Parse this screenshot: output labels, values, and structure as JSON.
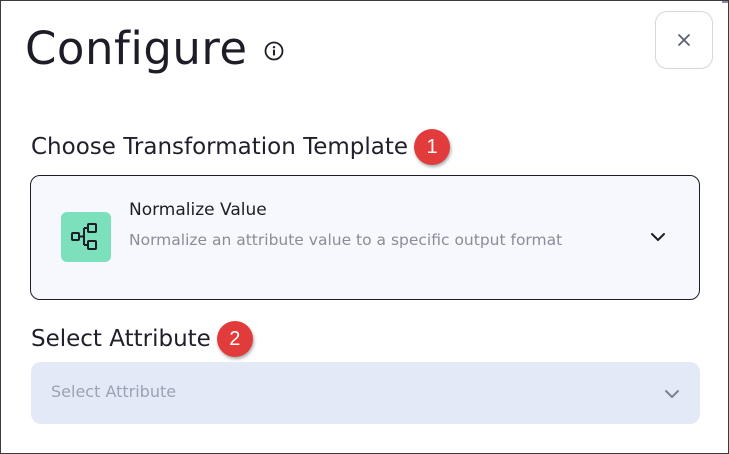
{
  "dialog": {
    "title": "Configure",
    "close_label": "×"
  },
  "sections": {
    "template": {
      "label": "Choose Transformation Template",
      "step": "1",
      "selected": {
        "name": "Normalize Value",
        "description": "Normalize an attribute value to a specific output format",
        "icon": "flow-tree-icon"
      }
    },
    "attribute": {
      "label": "Select Attribute",
      "step": "2",
      "placeholder": "Select Attribute"
    }
  },
  "colors": {
    "badge": "#e23b3b",
    "template_icon_bg": "#7de0bd",
    "template_select_bg": "#f6f8fd",
    "attribute_select_bg": "#e3e9f7"
  }
}
